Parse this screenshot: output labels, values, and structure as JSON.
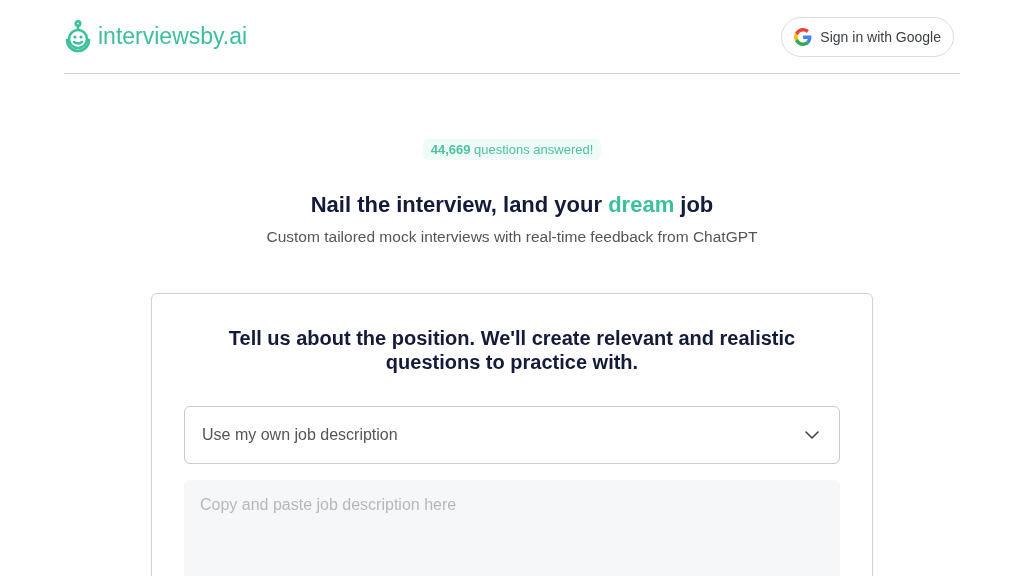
{
  "header": {
    "logo_text": "interviewsby.ai",
    "sign_in_button": "Sign in with Google"
  },
  "badge": {
    "count": "44,669",
    "text": "questions answered!"
  },
  "hero": {
    "headline_before": "Nail the interview, land your",
    "headline_highlight": "dream",
    "headline_after": "job",
    "subtitle": "Custom tailored mock interviews with real-time feedback from ChatGPT"
  },
  "card": {
    "title": "Tell us about the position. We'll create relevant and realistic questions to practice with.",
    "select": {
      "value": "Use my own job description"
    },
    "job_description": {
      "placeholder": "Copy and paste job description here"
    }
  }
}
